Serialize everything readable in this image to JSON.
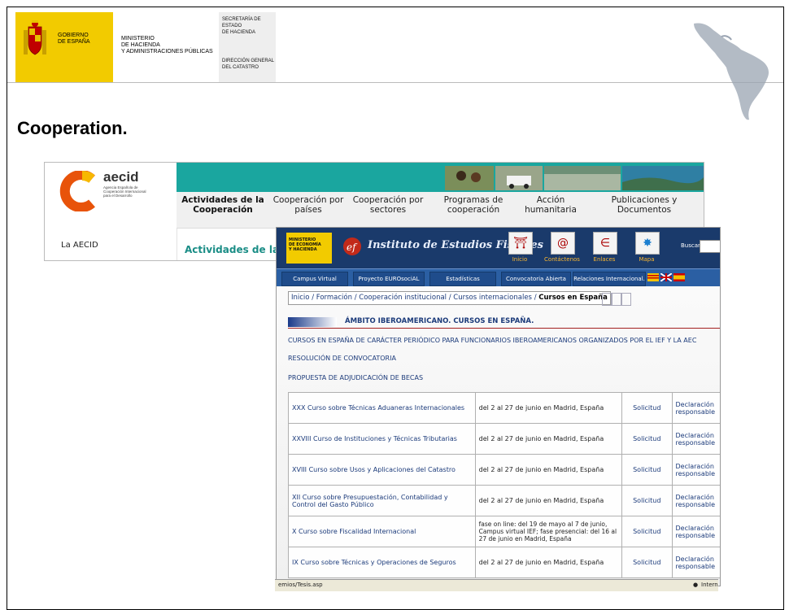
{
  "gov_header": {
    "gov_line1": "GOBIERNO",
    "gov_line2": "DE ESPAÑA",
    "ministry_line1": "MINISTERIO",
    "ministry_line2": "DE HACIENDA",
    "ministry_line3": "Y ADMINISTRACIONES PÚBLICAS",
    "sec_line1": "SECRETARÍA DE ESTADO",
    "sec_line2": "DE HACIENDA",
    "dir_line1": "DIRECCIÓN GENERAL",
    "dir_line2": "DEL CATASTRO",
    "accent": "#f2cb00"
  },
  "slide": {
    "title": "Cooperation."
  },
  "aecid": {
    "name": "aecid",
    "subtitle": "Agencia Española de Cooperación Internacional para el Desarrollo",
    "left_link": "La AECID",
    "menu": [
      {
        "line1": "Actividades de la",
        "line2": "Cooperación",
        "active": true
      },
      {
        "line1": "Cooperación por",
        "line2": "países"
      },
      {
        "line1": "Cooperación por",
        "line2": "sectores"
      },
      {
        "line1": "Programas de",
        "line2": "cooperación"
      },
      {
        "line1": "Acción",
        "line2": "humanitaria"
      },
      {
        "line1": "Publicaciones y",
        "line2": "Documentos"
      }
    ],
    "section_title": "Actividades de la C",
    "accent": "#1aa69f"
  },
  "ief": {
    "ministry_label_line1": "MINISTERIO",
    "ministry_label_line2": "DE ECONOMÍA",
    "ministry_label_line3": "Y HACIENDA",
    "name": "Instituto de Estudios Fiscales",
    "tools": [
      "Inicio",
      "Contáctenos",
      "Enlaces",
      "Mapa"
    ],
    "search_label": "Buscar",
    "nav_tabs": [
      "Campus Virtual",
      "Proyecto EUROsociAL",
      "Estadísticas",
      "Convocatoria Abierta",
      "Relaciones Internacional."
    ],
    "breadcrumb_path": "Inicio / Formación / Cooperación institucional / Cursos internacionales / ",
    "breadcrumb_current": "Cursos en España",
    "heading": "ÁMBITO IBEROAMERICANO. CURSOS EN ESPAÑA.",
    "links": [
      "CURSOS EN ESPAÑA DE CARÁCTER PERIÓDICO PARA FUNCIONARIOS IBEROAMERICANOS ORGANIZADOS POR EL IEF Y LA AEC",
      "RESOLUCIÓN DE CONVOCATORIA",
      "PROPUESTA DE ADJUDICACIÓN DE BECAS"
    ],
    "courses": [
      {
        "name": "XXX Curso sobre Técnicas Aduaneras Internacionales",
        "date": "del 2 al 27 de junio en Madrid, España",
        "apply": "Solicitud",
        "decl": "Declaración responsable"
      },
      {
        "name": "XXVIII Curso de Instituciones y Técnicas Tributarias",
        "date": "del 2 al 27 de junio en Madrid, España",
        "apply": "Solicitud",
        "decl": "Declaración responsable"
      },
      {
        "name": "XVIII Curso sobre Usos y Aplicaciones del Catastro",
        "date": "del 2 al 27 de junio en Madrid, España",
        "apply": "Solicitud",
        "decl": "Declaración responsable"
      },
      {
        "name": "XII Curso sobre Presupuestación, Contabilidad y Control del Gasto Público",
        "date": "del 2 al 27 de junio en Madrid, España",
        "apply": "Solicitud",
        "decl": "Declaración responsable"
      },
      {
        "name": "X Curso sobre Fiscalidad Internacional",
        "date": "fase on line: del 19 de mayo al 7 de junio, Campus virtual IEF; fase presencial: del 16 al 27 de junio en Madrid, España",
        "apply": "Solicitud",
        "decl": "Declaración responsable"
      },
      {
        "name": "IX Curso sobre Técnicas y Operaciones de Seguros",
        "date": "del 2 al 27 de junio en Madrid, España",
        "apply": "Solicitud",
        "decl": "Declaración responsable"
      }
    ],
    "status_left": "emios/Tesis.asp",
    "status_right": "Intern",
    "accent": "#1a3a6b"
  }
}
